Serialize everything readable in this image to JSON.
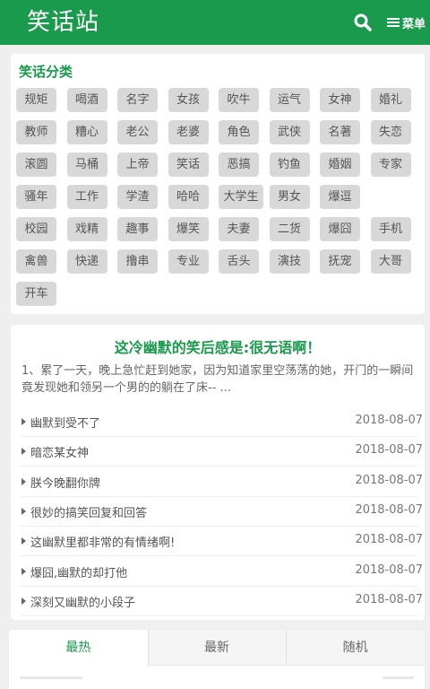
{
  "header": {
    "logo": "笑话站",
    "menu_label": "菜单"
  },
  "categories": {
    "title": "笑话分类",
    "items": [
      "规矩",
      "喝酒",
      "名字",
      "女孩",
      "吹牛",
      "运气",
      "女神",
      "婚礼",
      "教师",
      "糟心",
      "老公",
      "老婆",
      "角色",
      "武侠",
      "名著",
      "失恋",
      "滚圆",
      "马桶",
      "上帝",
      "笑话",
      "恶搞",
      "钓鱼",
      "婚姻",
      "专家",
      "骚年",
      "工作",
      "学渣",
      "哈哈",
      "大学生",
      "男女",
      "爆逗",
      "校园",
      "戏精",
      "趣事",
      "爆笑",
      "夫妻",
      "二货",
      "爆囧",
      "手机",
      "禽兽",
      "快递",
      "撸串",
      "专业",
      "舌头",
      "演技",
      "抚宠",
      "大哥",
      "开车"
    ]
  },
  "featured": {
    "title": "这冷幽默的笑后感是:很无语啊！",
    "excerpt": "1、累了一天，晚上急忙赶到她家，因为知道家里空荡荡的她，开门的一瞬间竟发现她和领另一个男的的躺在了床-- ..."
  },
  "joke_list": [
    {
      "title": "幽默到受不了",
      "date": "2018-08-07"
    },
    {
      "title": "暗恋某女神",
      "date": "2018-08-07"
    },
    {
      "title": "朕今晚翻你牌",
      "date": "2018-08-07"
    },
    {
      "title": "很妙的搞笑回复和回答",
      "date": "2018-08-07"
    },
    {
      "title": "这幽默里都非常的有情绪啊!",
      "date": "2018-08-07"
    },
    {
      "title": "爆囧,幽默的却打他",
      "date": "2018-08-07"
    },
    {
      "title": "深刻又幽默的小段子",
      "date": "2018-08-07"
    }
  ],
  "tabs": [
    {
      "label": "最热",
      "active": true
    },
    {
      "label": "最新",
      "active": false
    },
    {
      "label": "随机",
      "active": false
    }
  ],
  "colors": {
    "brand_green": "#1a9a4c",
    "tag_gray": "#d8d8d8"
  }
}
